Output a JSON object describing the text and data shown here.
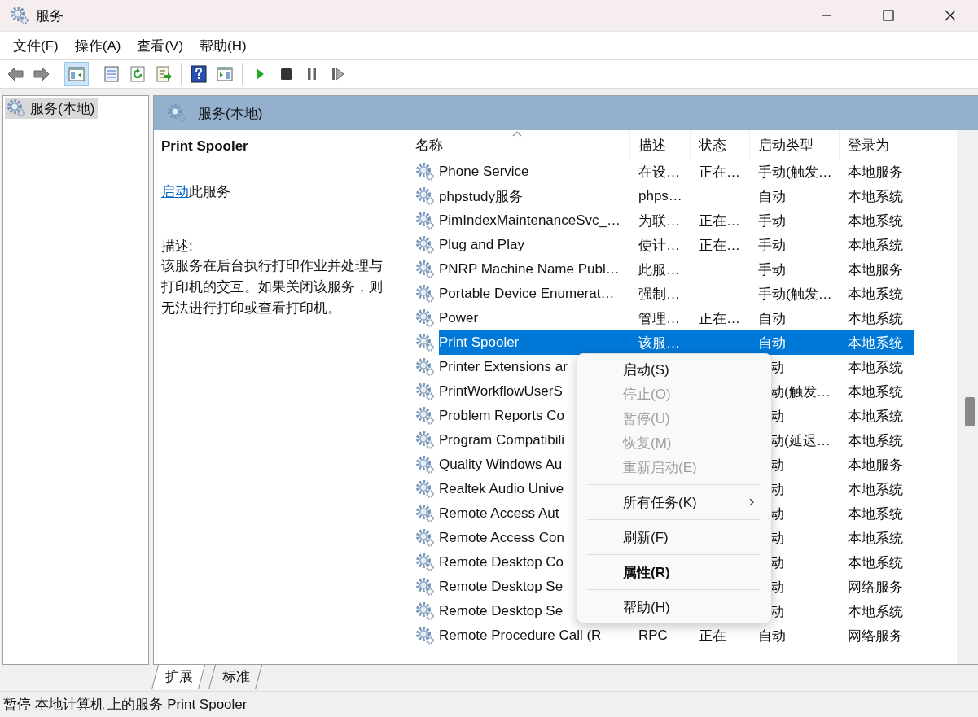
{
  "window": {
    "title": "服务"
  },
  "menu_bar": [
    "文件(F)",
    "操作(A)",
    "查看(V)",
    "帮助(H)"
  ],
  "toolbar": [
    {
      "kind": "back",
      "pressed": false
    },
    {
      "kind": "forward",
      "pressed": false
    },
    {
      "kind": "separator"
    },
    {
      "kind": "console-tree",
      "pressed": true
    },
    {
      "kind": "separator"
    },
    {
      "kind": "list",
      "pressed": false
    },
    {
      "kind": "refresh",
      "pressed": false
    },
    {
      "kind": "export",
      "pressed": false
    },
    {
      "kind": "separator"
    },
    {
      "kind": "help",
      "pressed": false
    },
    {
      "kind": "action-pane",
      "pressed": false
    },
    {
      "kind": "separator"
    },
    {
      "kind": "play",
      "pressed": false
    },
    {
      "kind": "stop",
      "pressed": false
    },
    {
      "kind": "pause",
      "pressed": false
    },
    {
      "kind": "resume",
      "pressed": false
    }
  ],
  "tree": {
    "items": [
      {
        "label": "服务(本地)",
        "selected": true
      }
    ]
  },
  "panel": {
    "title": "服务(本地)"
  },
  "details": {
    "service_name": "Print Spooler",
    "action": {
      "link": "启动",
      "text": "此服务"
    },
    "description_label": "描述:",
    "description": "该服务在后台执行打印作业并处理与打印机的交互。如果关闭该服务，则无法进行打印或查看打印机。"
  },
  "services": {
    "columns": [
      {
        "label": "名称",
        "sorted": true
      },
      {
        "label": "描述",
        "sorted": false
      },
      {
        "label": "状态",
        "sorted": false
      },
      {
        "label": "启动类型",
        "sorted": false
      },
      {
        "label": "登录为",
        "sorted": false
      }
    ],
    "rows": [
      {
        "name": "Phone Service",
        "description": "在设…",
        "status": "正在…",
        "startup_type": "手动(触发…",
        "log_on_as": "本地服务",
        "selected": false
      },
      {
        "name": "phpstudy服务",
        "description": "phps…",
        "startup_type": "自动",
        "log_on_as": "本地系统",
        "selected": false
      },
      {
        "name": "PimIndexMaintenanceSvc_…",
        "description": "为联…",
        "status": "正在…",
        "startup_type": "手动",
        "log_on_as": "本地系统",
        "selected": false
      },
      {
        "name": "Plug and Play",
        "description": "使计…",
        "status": "正在…",
        "startup_type": "手动",
        "log_on_as": "本地系统",
        "selected": false
      },
      {
        "name": "PNRP Machine Name Publ…",
        "description": "此服…",
        "startup_type": "手动",
        "log_on_as": "本地服务",
        "selected": false
      },
      {
        "name": "Portable Device Enumerat…",
        "description": "强制…",
        "startup_type": "手动(触发…",
        "log_on_as": "本地系统",
        "selected": false
      },
      {
        "name": "Power",
        "description": "管理…",
        "status": "正在…",
        "startup_type": "自动",
        "log_on_as": "本地系统",
        "selected": false
      },
      {
        "name": "Print Spooler",
        "description": "该服…",
        "startup_type": "自动",
        "log_on_as": "本地系统",
        "selected": true
      },
      {
        "name": "Printer Extensions ar",
        "startup_type_visible": "动",
        "log_on_as": "本地系统",
        "selected": false
      },
      {
        "name": "PrintWorkflowUserS",
        "startup_type_visible": "动(触发…",
        "log_on_as": "本地系统",
        "selected": false
      },
      {
        "name": "Problem Reports Co",
        "startup_type_visible": "动",
        "log_on_as": "本地系统",
        "selected": false
      },
      {
        "name": "Program Compatibili",
        "startup_type_visible": "动(延迟…",
        "log_on_as": "本地系统",
        "selected": false
      },
      {
        "name": "Quality Windows Au",
        "startup_type_visible": "动",
        "log_on_as": "本地服务",
        "selected": false
      },
      {
        "name": "Realtek Audio Unive",
        "startup_type_visible": "动",
        "log_on_as": "本地系统",
        "selected": false
      },
      {
        "name": "Remote Access Aut",
        "startup_type_visible": "动",
        "log_on_as": "本地系统",
        "selected": false
      },
      {
        "name": "Remote Access Con",
        "startup_type_visible": "动",
        "log_on_as": "本地系统",
        "selected": false
      },
      {
        "name": "Remote Desktop Co",
        "startup_type_visible": "动",
        "log_on_as": "本地系统",
        "selected": false
      },
      {
        "name": "Remote Desktop Se",
        "startup_type_visible": "动",
        "log_on_as": "网络服务",
        "selected": false
      },
      {
        "name": "Remote Desktop Se",
        "startup_type_visible": "动",
        "log_on_as": "本地系统",
        "selected": false
      },
      {
        "name": "Remote Procedure Call (R",
        "description": "RPC",
        "status": "正在",
        "startup_type": "自动",
        "log_on_as": "网络服务",
        "selected": false
      }
    ]
  },
  "context_menu": {
    "items": [
      {
        "kind": "item",
        "label": "启动(S)",
        "disabled": false,
        "submenu": false,
        "default": false
      },
      {
        "kind": "item",
        "label": "停止(O)",
        "disabled": true,
        "submenu": false,
        "default": false
      },
      {
        "kind": "item",
        "label": "暂停(U)",
        "disabled": true,
        "submenu": false,
        "default": false
      },
      {
        "kind": "item",
        "label": "恢复(M)",
        "disabled": true,
        "submenu": false,
        "default": false
      },
      {
        "kind": "item",
        "label": "重新启动(E)",
        "disabled": true,
        "submenu": false,
        "default": false
      },
      {
        "kind": "separator"
      },
      {
        "kind": "item",
        "label": "所有任务(K)",
        "disabled": false,
        "submenu": true,
        "default": false
      },
      {
        "kind": "separator"
      },
      {
        "kind": "item",
        "label": "刷新(F)",
        "disabled": false,
        "submenu": false,
        "default": false
      },
      {
        "kind": "separator"
      },
      {
        "kind": "item",
        "label": "属性(R)",
        "disabled": false,
        "submenu": false,
        "default": true
      },
      {
        "kind": "separator"
      },
      {
        "kind": "item",
        "label": "帮助(H)",
        "disabled": false,
        "submenu": false,
        "default": false
      }
    ]
  },
  "bottom_tabs": [
    {
      "label": "扩展",
      "selected": true
    },
    {
      "label": "标准",
      "selected": false
    }
  ],
  "status_bar": "暂停 本地计算机 上的服务 Print Spooler"
}
